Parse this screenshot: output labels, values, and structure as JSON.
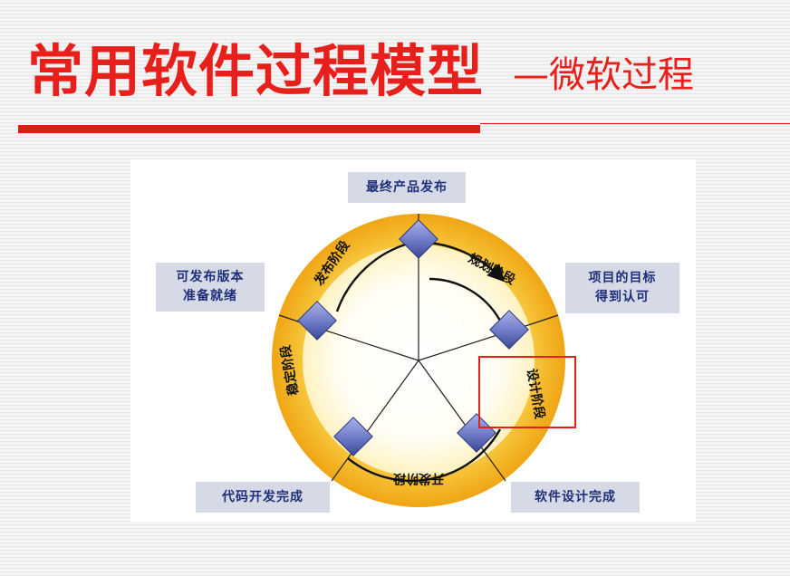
{
  "title": {
    "main": "常用软件过程模型",
    "sub": "—微软过程"
  },
  "milestones": {
    "final_release": "最终产品发布",
    "goals_approved": "项目的目标\n得到认可",
    "design_done": "软件设计完成",
    "code_done": "代码开发完成",
    "release_ready": "可发布版本\n准备就绪"
  },
  "phases": {
    "planning": "规划阶段",
    "design": "设计阶段",
    "development": "开发阶段",
    "stabilization": "稳定阶段",
    "deployment": "发布阶段"
  },
  "colors": {
    "title_red": "#e8201b",
    "ring_outer": "#f2b11b",
    "ring_inner": "#fde9a0",
    "diamond": "#6e79c6",
    "label_box_bg": "#d6d9e6",
    "label_text": "#1e2f7a"
  },
  "icons": {
    "milestone": "diamond-icon",
    "flow_arrow": "arrow-icon"
  }
}
